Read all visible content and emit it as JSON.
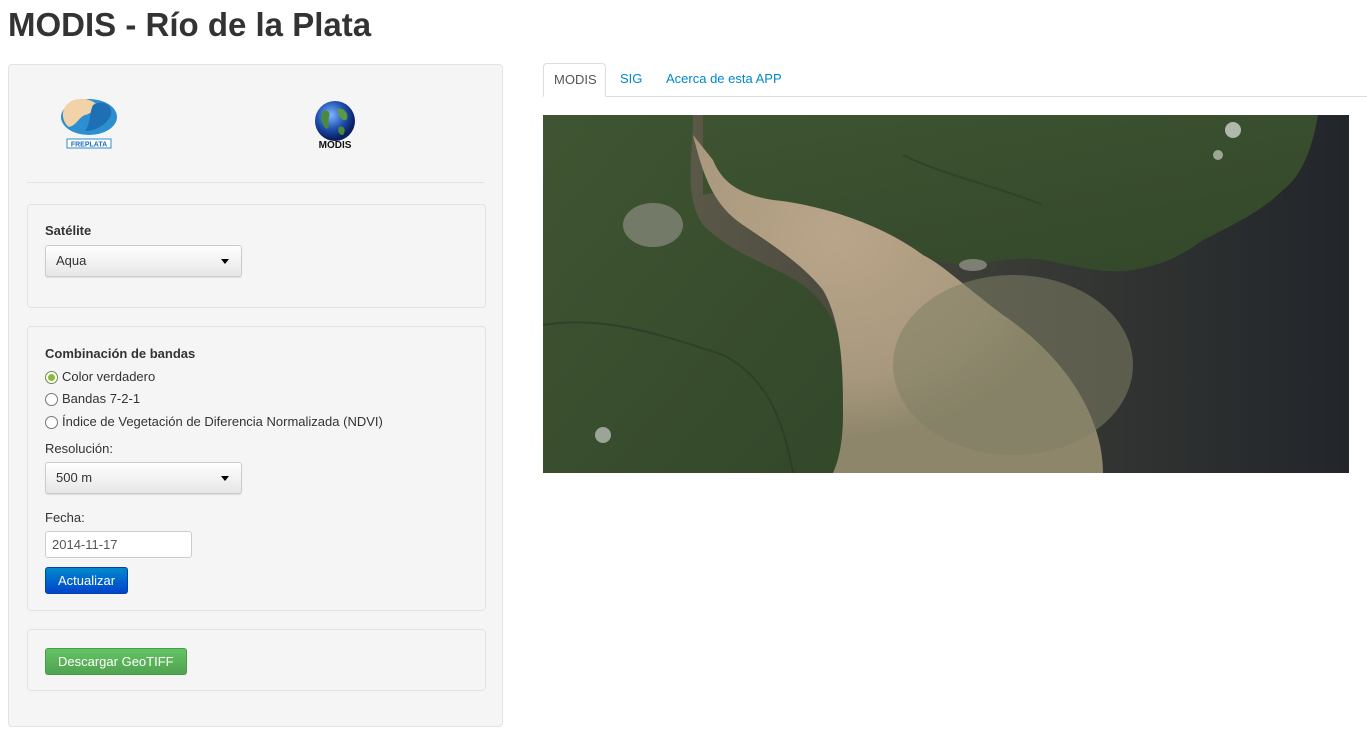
{
  "page": {
    "title": "MODIS - Río de la Plata"
  },
  "logos": {
    "freplata": "FREPLATA",
    "modis": "MODIS"
  },
  "satellite": {
    "label": "Satélite",
    "selected": "Aqua"
  },
  "bands": {
    "label": "Combinación de bandas",
    "options": [
      {
        "label": "Color verdadero",
        "checked": true
      },
      {
        "label": "Bandas 7-2-1",
        "checked": false
      },
      {
        "label": "Índice de Vegetación de Diferencia Normalizada (NDVI)",
        "checked": false
      }
    ]
  },
  "resolution": {
    "label": "Resolución:",
    "selected": "500 m"
  },
  "date": {
    "label": "Fecha:",
    "value": "2014-11-17"
  },
  "buttons": {
    "update": "Actualizar",
    "download": "Descargar GeoTIFF"
  },
  "tabs": [
    {
      "label": "MODIS",
      "active": true
    },
    {
      "label": "SIG",
      "active": false
    },
    {
      "label": "Acerca de esta APP",
      "active": false
    }
  ],
  "colors": {
    "primary": "#0055cc",
    "success": "#5bb75b",
    "link": "#0088cc"
  }
}
